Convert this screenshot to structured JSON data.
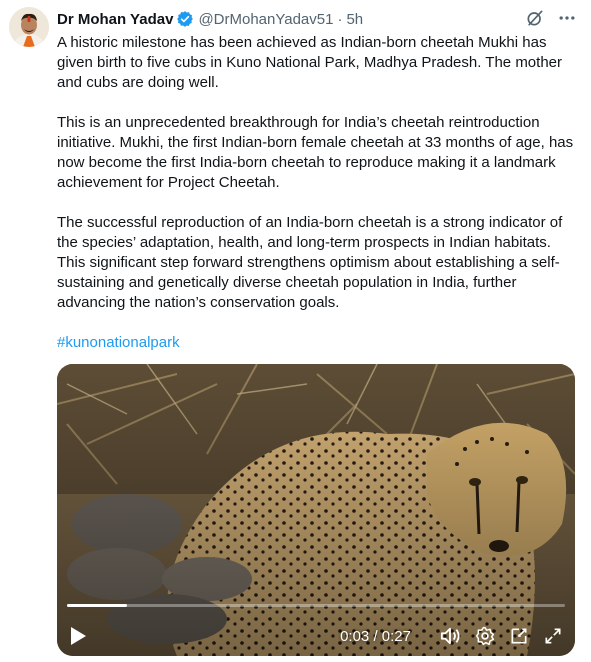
{
  "post": {
    "author_name": "Dr Mohan Yadav",
    "handle": "@DrMohanYadav51",
    "separator": "·",
    "time": "5h",
    "verified": true,
    "paragraphs": [
      "A historic milestone has been achieved as Indian-born cheetah Mukhi has given birth to five cubs in Kuno National Park, Madhya Pradesh. The mother and cubs are doing well.",
      "This is an unprecedented breakthrough for India’s cheetah reintroduction initiative. Mukhi, the first Indian-born female cheetah at 33 months of age, has now become the first India-born cheetah to reproduce making it a landmark achievement for Project Cheetah.",
      "The successful reproduction of an India-born cheetah is a strong indicator of the species’ adaptation, health, and long-term prospects in Indian habitats. This significant step forward strengthens optimism about establishing a self-sustaining and genetically diverse cheetah population in India, further advancing the nation’s conservation goals."
    ],
    "hashtag": "#kunonationalpark"
  },
  "icons": {
    "verified": "verified-badge-icon",
    "grok": "grok-icon",
    "more": "more-icon",
    "play": "play-icon",
    "volume": "volume-icon",
    "settings": "settings-icon",
    "pip": "picture-in-picture-icon",
    "fullscreen": "fullscreen-icon"
  },
  "video": {
    "current_time": "0:03",
    "time_separator": "/",
    "duration": "0:27",
    "progress": 0.12
  },
  "colors": {
    "text": "#0f1419",
    "secondary": "#536471",
    "link": "#1d9bf0",
    "verified": "#1d9bf0"
  }
}
